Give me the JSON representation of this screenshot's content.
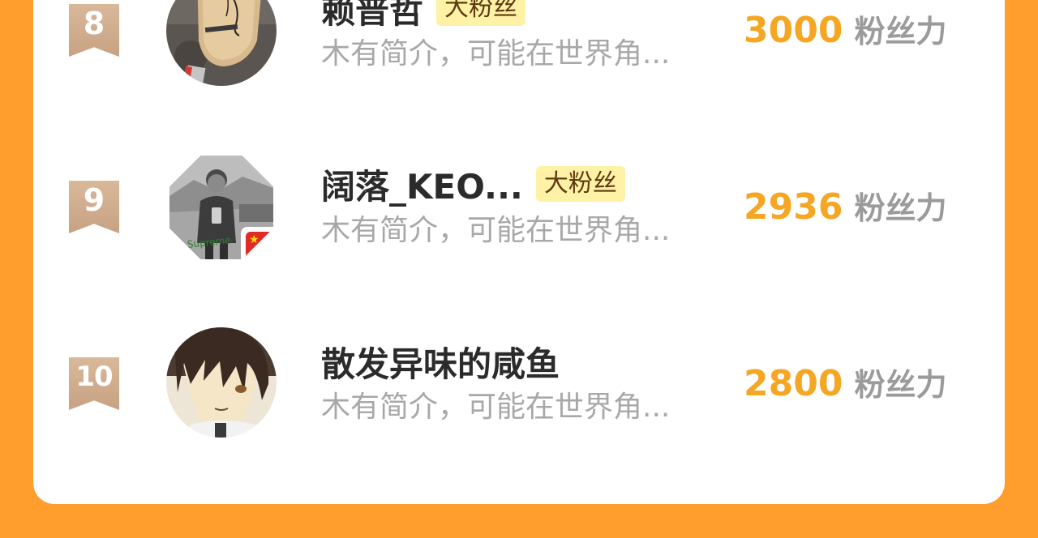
{
  "colors": {
    "background": "#FF9D2D",
    "card": "#FFFFFF",
    "score": "#F5A623",
    "tag_bg": "#FFF1A6",
    "rank_badge": "#D0AC8D"
  },
  "rows": [
    {
      "rank": "8",
      "name": "赖普哲",
      "tag": "大粉丝",
      "bio": "木有简介，可能在世界角...",
      "score": "3000",
      "unit": "粉丝力",
      "avatar": "paddle-photo-avatar"
    },
    {
      "rank": "9",
      "name": "阔落_KEO...",
      "tag": "大粉丝",
      "bio": "木有简介，可能在世界角...",
      "score": "2936",
      "unit": "粉丝力",
      "avatar": "boy-photo-avatar"
    },
    {
      "rank": "10",
      "name": "散发异味的咸鱼",
      "bio": "木有简介，可能在世界角...",
      "score": "2800",
      "unit": "粉丝力",
      "avatar": "anime-boy-avatar"
    }
  ]
}
